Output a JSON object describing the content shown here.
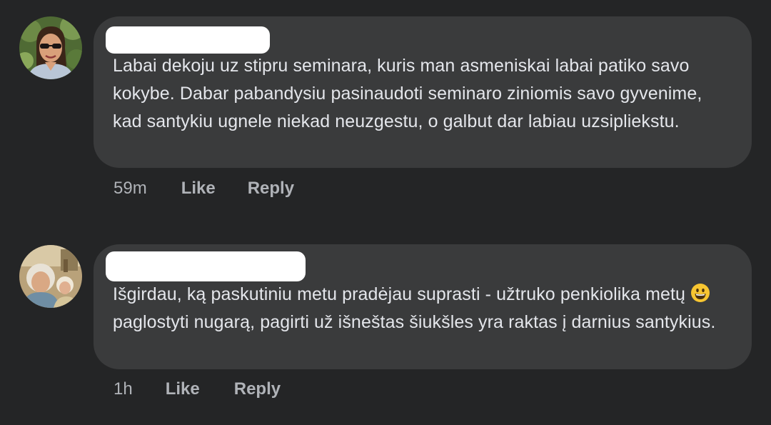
{
  "comments": [
    {
      "avatar": "avatar-woman-sunglasses",
      "author": "",
      "text": "Labai dekoju uz stipru seminara, kuris man asmeniskai labai patiko savo kokybe. Dabar pabandysiu pasinaudoti seminaro ziniomis savo gyvenime, kad santykiu ugnele niekad neuzgestu, o galbut dar labiau uzsipliekstu.",
      "time": "59m",
      "like": "Like",
      "reply": "Reply"
    },
    {
      "avatar": "avatar-woman-gray-hair",
      "author": "",
      "text_before_emoji": "Išgirdau, ką paskutiniu metu pradėjau suprasti - užtruko penkiolika metų",
      "emoji": "grinning-face-emoji",
      "text_after_emoji": "paglostyti nugarą, pagirti už išneštas šiukšles yra raktas į darnius santykius.",
      "time": "1h",
      "like": "Like",
      "reply": "Reply"
    }
  ],
  "colors": {
    "background": "#242526",
    "bubble": "#3a3b3c",
    "text": "#e4e6eb",
    "secondary_text": "#b0b3b8"
  }
}
